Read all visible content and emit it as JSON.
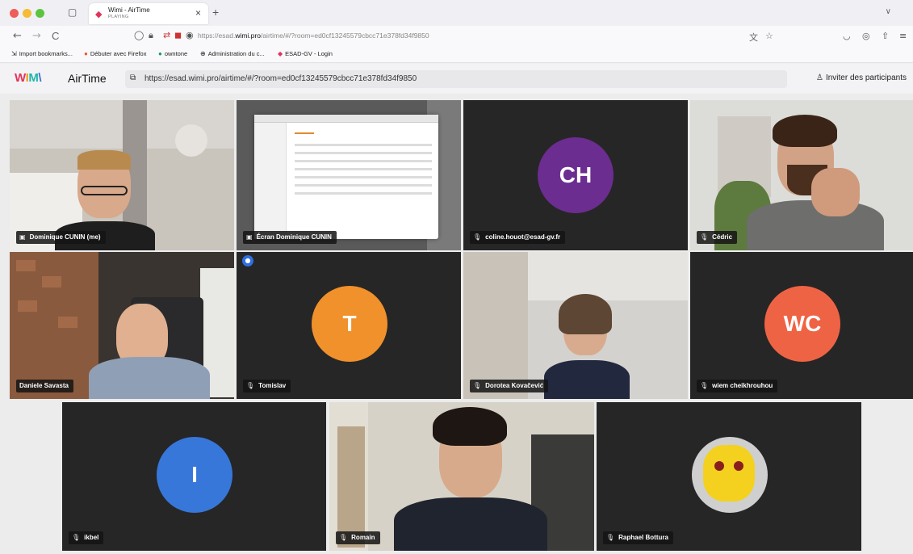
{
  "browser": {
    "tab": {
      "title": "Wimi - AirTime",
      "subtitle": "PLAYING",
      "close": "×"
    },
    "new_tab": "+",
    "tab_list": "∨",
    "nav": {
      "back": "←",
      "forward": "→",
      "reload": "C"
    },
    "url": {
      "prefix": "https://esad.",
      "domain": "wimi.pro",
      "suffix": "/airtime/#/?room=ed0cf13245579cbcc71e378fd34f9850"
    },
    "bookmarks": [
      {
        "label": "Import bookmarks...",
        "icon": "import-icon"
      },
      {
        "label": "Débuter avec Firefox",
        "icon": "firefox-icon"
      },
      {
        "label": "owntone",
        "icon": "owntone-icon"
      },
      {
        "label": "Administration du c...",
        "icon": "globe-icon"
      },
      {
        "label": "ESAD-GV - Login",
        "icon": "esad-icon"
      }
    ]
  },
  "app": {
    "logo": {
      "w": "W",
      "i": "I",
      "m": "M",
      "x": "\\"
    },
    "title": "AirTime",
    "room_url": "https://esad.wimi.pro/airtime/#/?room=ed0cf13245579cbcc71e378fd34f9850",
    "invite_label": "Inviter des participants"
  },
  "participants": [
    {
      "name": "Dominique CUNIN (me)",
      "type": "video",
      "icon": "screen-icon"
    },
    {
      "name": "Écran Dominique CUNIN",
      "type": "screenshare",
      "icon": "screen-icon"
    },
    {
      "name": "coline.houot@esad-gv.fr",
      "type": "avatar",
      "initials": "CH",
      "color": "#6b2d8f",
      "icon": "mic-off-icon"
    },
    {
      "name": "Cédric",
      "type": "video",
      "icon": "mic-off-icon"
    },
    {
      "name": "Daniele Savasta",
      "type": "video",
      "active": true
    },
    {
      "name": "Tomislav",
      "type": "avatar",
      "initials": "T",
      "color": "#f0912b",
      "icon": "mic-off-icon"
    },
    {
      "name": "Dorotea Kovačević",
      "type": "video",
      "icon": "mic-off-icon"
    },
    {
      "name": "wiem cheikhrouhou",
      "type": "avatar",
      "initials": "WC",
      "color": "#ef6345",
      "icon": "mic-off-icon"
    },
    {
      "name": "ikbel",
      "type": "avatar",
      "initials": "I",
      "color": "#3777d9",
      "icon": "mic-off-icon"
    },
    {
      "name": "Romain",
      "type": "video",
      "icon": "mic-off-icon"
    },
    {
      "name": "Raphael Bottura",
      "type": "image-avatar",
      "icon": "mic-off-icon"
    }
  ],
  "colors": {
    "active_border": "#3b82f6",
    "tile_bg": "#262626"
  }
}
